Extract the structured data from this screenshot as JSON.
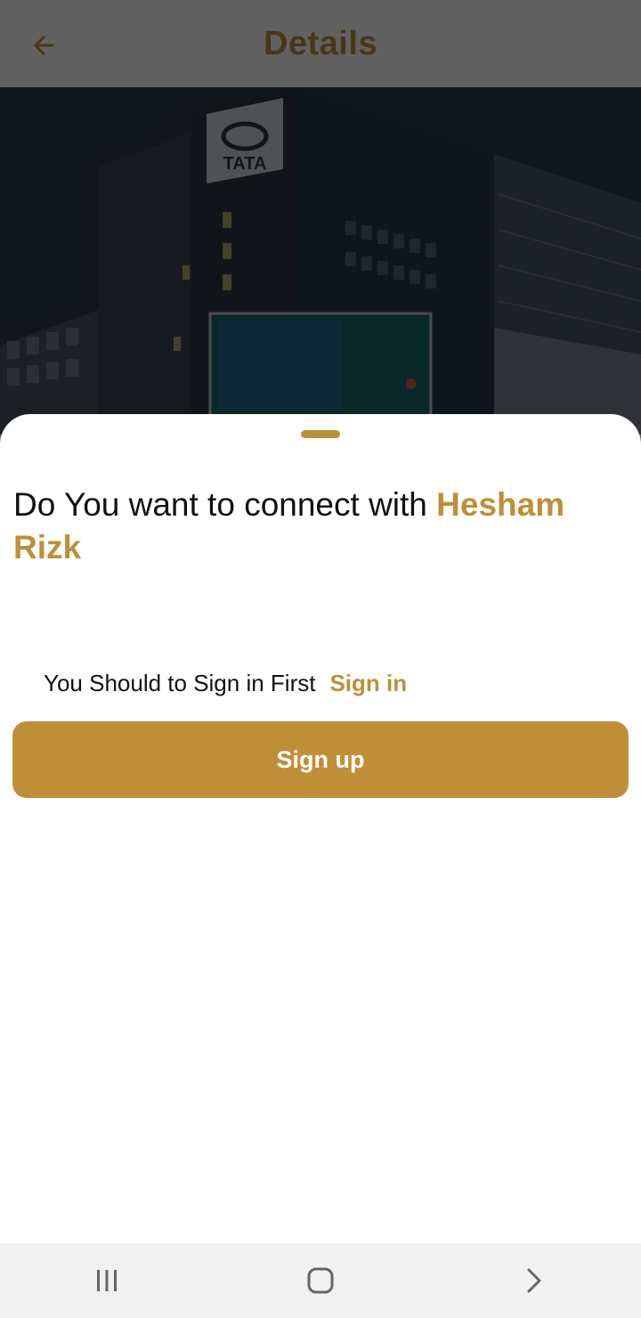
{
  "appbar": {
    "title": "Details",
    "back_icon": "arrow-left-icon"
  },
  "hero": {
    "logo_text": "TATA"
  },
  "sheet": {
    "question_prefix": "Do You want to connect with ",
    "question_name": "Hesham Rizk",
    "signin_hint": "You Should to Sign in First",
    "signin_link": "Sign in",
    "signup_label": "Sign up"
  },
  "navbar": {
    "recents_icon": "recents-icon",
    "home_icon": "home-icon",
    "back_icon": "chevron-right-icon"
  },
  "colors": {
    "accent": "#bf8f38",
    "text": "#111111",
    "scrim": "rgba(0,0,0,0.62)",
    "navbar_bg": "#f1f1f1"
  }
}
